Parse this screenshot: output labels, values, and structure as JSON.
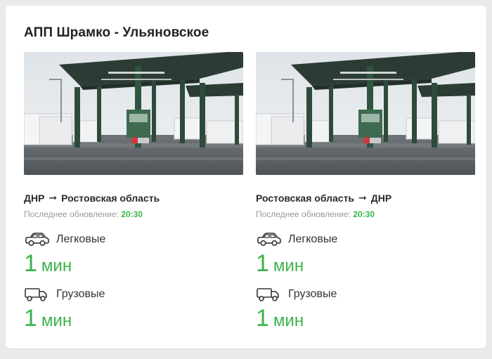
{
  "checkpoint": {
    "title": "АПП Шрамко - Ульяновское"
  },
  "directions": [
    {
      "from": "ДНР",
      "to": "Ростовская область",
      "arrow": "➞",
      "updated_label": "Последнее обновление:",
      "updated_time": "20:30",
      "cars": {
        "label": "Легковые",
        "icon": "car-icon",
        "wait_value": "1",
        "wait_unit": "мин"
      },
      "trucks": {
        "label": "Грузовые",
        "icon": "truck-icon",
        "wait_value": "1",
        "wait_unit": "мин"
      }
    },
    {
      "from": "Ростовская область",
      "to": "ДНР",
      "arrow": "➞",
      "updated_label": "Последнее обновление:",
      "updated_time": "20:30",
      "cars": {
        "label": "Легковые",
        "icon": "car-icon",
        "wait_value": "1",
        "wait_unit": "мин"
      },
      "trucks": {
        "label": "Грузовые",
        "icon": "truck-icon",
        "wait_value": "1",
        "wait_unit": "мин"
      }
    }
  ],
  "colors": {
    "accent_green": "#3bb34a",
    "muted_text": "#9a9a9a",
    "canopy": "#2b3a33",
    "sky": "#e4e8ec"
  }
}
